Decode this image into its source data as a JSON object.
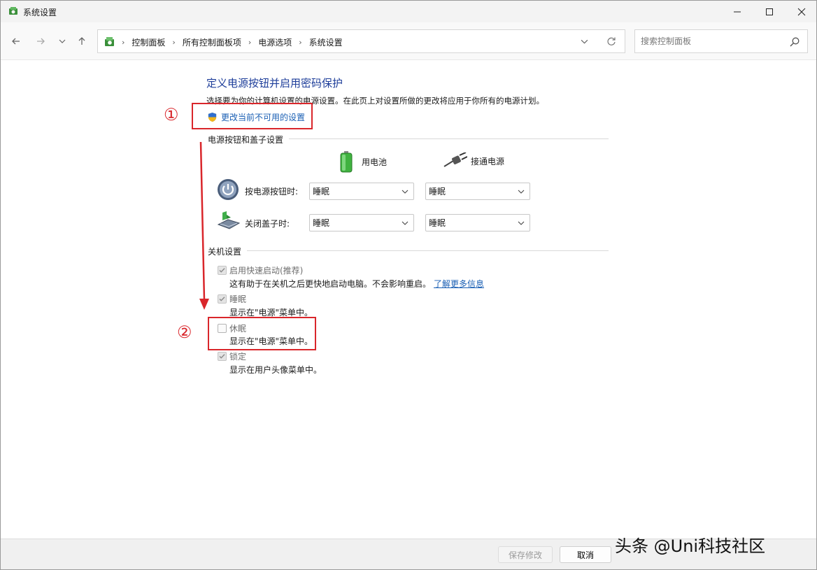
{
  "window": {
    "title": "系统设置"
  },
  "breadcrumb": {
    "items": [
      "控制面板",
      "所有控制面板项",
      "电源选项",
      "系统设置"
    ]
  },
  "search": {
    "placeholder": "搜索控制面板"
  },
  "main": {
    "heading": "定义电源按钮并启用密码保护",
    "description": "选择要为你的计算机设置的电源设置。在此页上对设置所做的更改将应用于你所有的电源计划。",
    "change_link": "更改当前不可用的设置",
    "power_group_title": "电源按钮和盖子设置",
    "col_battery": "用电池",
    "col_plugged": "接通电源",
    "rows": [
      {
        "label": "按电源按钮时:",
        "battery": "睡眠",
        "plugged": "睡眠"
      },
      {
        "label": "关闭盖子时:",
        "battery": "睡眠",
        "plugged": "睡眠"
      }
    ],
    "shutdown_group_title": "关机设置",
    "options": [
      {
        "label": "启用快速启动(推荐)",
        "desc": "这有助于在关机之后更快地启动电脑。不会影响重启。",
        "link": "了解更多信息",
        "checked": true
      },
      {
        "label": "睡眠",
        "desc": "显示在\"电源\"菜单中。",
        "checked": true
      },
      {
        "label": "休眠",
        "desc": "显示在\"电源\"菜单中。",
        "checked": false
      },
      {
        "label": "锁定",
        "desc": "显示在用户头像菜单中。",
        "checked": true
      }
    ]
  },
  "annotations": {
    "step1": "①",
    "step2": "②",
    "color": "#d9262b"
  },
  "footer": {
    "save_label": "保存修改",
    "cancel_label": "取消"
  },
  "watermark": "头条 @Uni科技社区",
  "colors": {
    "heading": "#1e3e9a",
    "link": "#1a5fb4"
  }
}
